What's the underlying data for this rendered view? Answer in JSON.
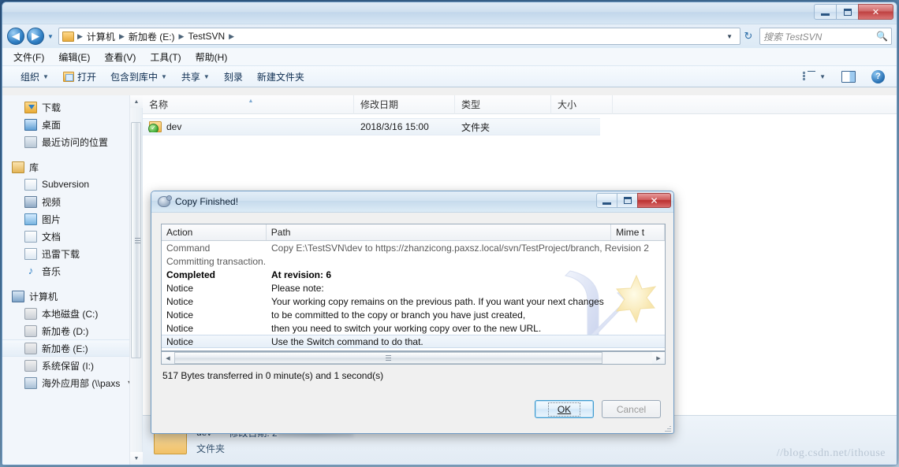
{
  "window": {
    "title": "",
    "buttons": {
      "minimize": "minimize-icon",
      "maximize": "maximize-icon",
      "close": "✕"
    }
  },
  "address": {
    "back_icon": "◀",
    "forward_icon": "▶",
    "history_caret": "▼",
    "crumbs": [
      "计算机",
      "新加卷 (E:)",
      "TestSVN"
    ],
    "separator": "▶",
    "dropdown_caret": "▼",
    "refresh_icon": "↻"
  },
  "search": {
    "placeholder": "搜索 TestSVN",
    "icon": "search-icon"
  },
  "menubar": {
    "items": [
      "文件(F)",
      "编辑(E)",
      "查看(V)",
      "工具(T)",
      "帮助(H)"
    ]
  },
  "commandbar": {
    "organize": "组织",
    "open": "打开",
    "include_in_library": "包含到库中",
    "share": "共享",
    "burn": "刻录",
    "new_folder": "新建文件夹",
    "caret": "▼",
    "views_icon": "view-options-icon",
    "preview_pane_icon": "preview-pane-icon",
    "help_icon": "?"
  },
  "navpane": {
    "groups": [
      {
        "items": [
          {
            "label": "下载",
            "icon": "downloads-icon",
            "indent": 1
          },
          {
            "label": "桌面",
            "icon": "desktop-icon",
            "indent": 1
          },
          {
            "label": "最近访问的位置",
            "icon": "recent-places-icon",
            "indent": 1
          }
        ]
      },
      {
        "items": [
          {
            "label": "库",
            "icon": "library-icon",
            "indent": 0
          },
          {
            "label": "Subversion",
            "icon": "document-library-icon",
            "indent": 1
          },
          {
            "label": "视频",
            "icon": "video-library-icon",
            "indent": 1
          },
          {
            "label": "图片",
            "icon": "pictures-library-icon",
            "indent": 1
          },
          {
            "label": "文档",
            "icon": "documents-library-icon",
            "indent": 1
          },
          {
            "label": "迅雷下载",
            "icon": "thunder-download-icon",
            "indent": 1
          },
          {
            "label": "音乐",
            "icon": "music-library-icon",
            "indent": 1
          }
        ]
      },
      {
        "items": [
          {
            "label": "计算机",
            "icon": "computer-icon",
            "indent": 0
          },
          {
            "label": "本地磁盘 (C:)",
            "icon": "local-disk-icon",
            "indent": 1
          },
          {
            "label": "新加卷 (D:)",
            "icon": "drive-icon",
            "indent": 1
          },
          {
            "label": "新加卷 (E:)",
            "icon": "drive-icon",
            "indent": 1,
            "selected": true
          },
          {
            "label": "系统保留 (I:)",
            "icon": "drive-icon",
            "indent": 1
          },
          {
            "label": "海外应用部 (\\\\paxs",
            "icon": "network-drive-icon",
            "indent": 1,
            "truncated": true
          }
        ]
      }
    ],
    "scrollbar": {
      "up": "▲",
      "down": "▼"
    }
  },
  "filelist": {
    "columns": [
      {
        "label": "名称",
        "sorted": true
      },
      {
        "label": "修改日期",
        "sorted": false
      },
      {
        "label": "类型",
        "sorted": false
      },
      {
        "label": "大小",
        "sorted": false
      }
    ],
    "rows": [
      {
        "name": "dev",
        "date": "2018/3/16 15:00",
        "type": "文件夹",
        "size": "",
        "icon": "folder-svn-normal-icon"
      }
    ]
  },
  "detailspane": {
    "name": "dev",
    "date_label": "修改日期:",
    "date_value_prefix": "2",
    "kind": "文件夹",
    "icon": "large-folder-icon"
  },
  "watermark": "//blog.csdn.net/ithouse",
  "dialog": {
    "title": "Copy Finished!",
    "icon": "tortoisesvn-icon",
    "buttons": {
      "minimize": "minimize-icon",
      "maximize": "maximize-icon",
      "close": "✕"
    },
    "log": {
      "columns": [
        "Action",
        "Path",
        "Mime t"
      ],
      "rows": [
        {
          "action": "Command",
          "path": "Copy E:\\TestSVN\\dev to https://zhanzicong.paxsz.local/svn/TestProject/branch, Revision 2",
          "style": "normal"
        },
        {
          "action": "Committing transaction...",
          "path": "",
          "style": "normal"
        },
        {
          "action": "Completed",
          "path": "At revision: 6",
          "style": "bold"
        },
        {
          "action": "Notice",
          "path": "Please note:",
          "style": "dark"
        },
        {
          "action": "Notice",
          "path": "Your working copy remains on the previous path. If you want your next changes",
          "style": "dark"
        },
        {
          "action": "Notice",
          "path": "to be committed to the copy or branch you have just created,",
          "style": "dark"
        },
        {
          "action": "Notice",
          "path": "then you need to switch your working copy over to the new URL.",
          "style": "dark"
        },
        {
          "action": "Notice",
          "path": "Use the Switch command to do that.",
          "style": "dark",
          "selected": true
        }
      ],
      "hscroll": {
        "left": "◀",
        "right": "▶"
      }
    },
    "status": "517 Bytes transferred in 0 minute(s) and 1 second(s)",
    "ok_button": "OK",
    "ok_accel": "O",
    "cancel_button": "Cancel"
  }
}
